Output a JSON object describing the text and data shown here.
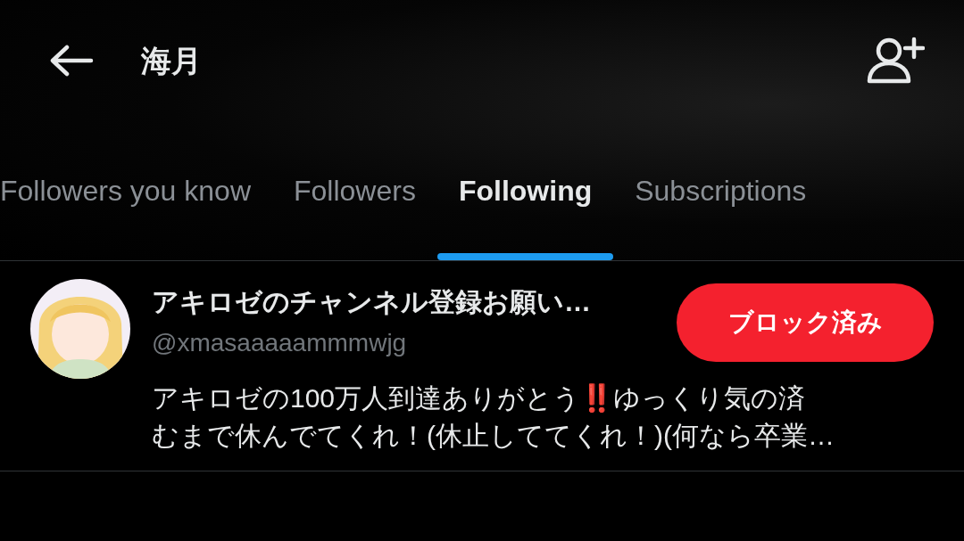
{
  "header": {
    "title": "海月"
  },
  "tabs": [
    {
      "label": "Followers you know",
      "selected": false
    },
    {
      "label": "Followers",
      "selected": false
    },
    {
      "label": "Following",
      "selected": true
    },
    {
      "label": "Subscriptions",
      "selected": false
    }
  ],
  "users": [
    {
      "name": "アキロゼのチャンネル登録お願い…",
      "handle": "@xmasaaaaammmwjg",
      "button": "ブロック済み",
      "bio_lines": [
        "アキロゼの100万人到達ありがとう‼️ゆっくり気の済",
        "むまで休んでてくれ！(休止しててくれ！)(何なら卒業…"
      ]
    }
  ]
}
